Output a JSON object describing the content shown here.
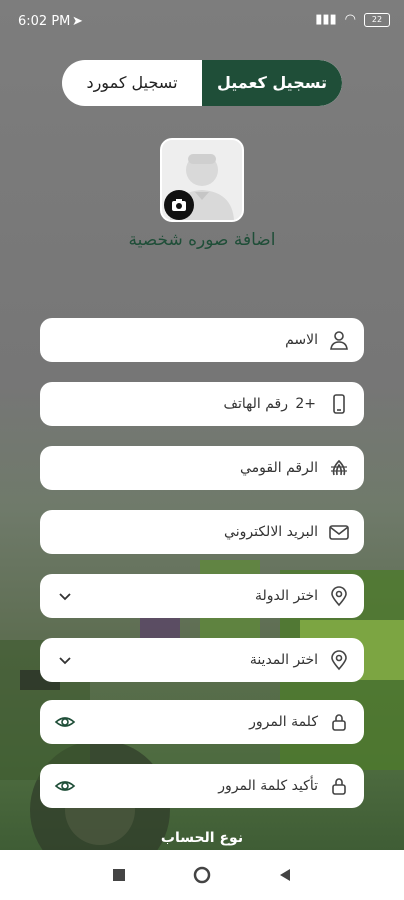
{
  "status_bar": {
    "time": "6:02 PM",
    "battery": "22"
  },
  "mode_toggle": {
    "active_label": "تسجيل كعميل",
    "inactive_label": "تسجيل كمورد"
  },
  "avatar": {
    "caption": "اضافة صوره شخصية"
  },
  "form": {
    "name_placeholder": "الاسم",
    "phone_prefix": "+2",
    "phone_placeholder": "رقم الهاتف",
    "national_id_placeholder": "الرقم القومي",
    "email_placeholder": "البريد الالكتروني",
    "country_placeholder": "اختر الدولة",
    "city_placeholder": "اختر المدينة",
    "password_placeholder": "كلمة المرور",
    "confirm_password_placeholder": "تأكيد كلمة المرور"
  },
  "account_type_heading": "نوع الحساب",
  "colors": {
    "primary": "#1f4e38",
    "field_bg": "#ffffff"
  }
}
